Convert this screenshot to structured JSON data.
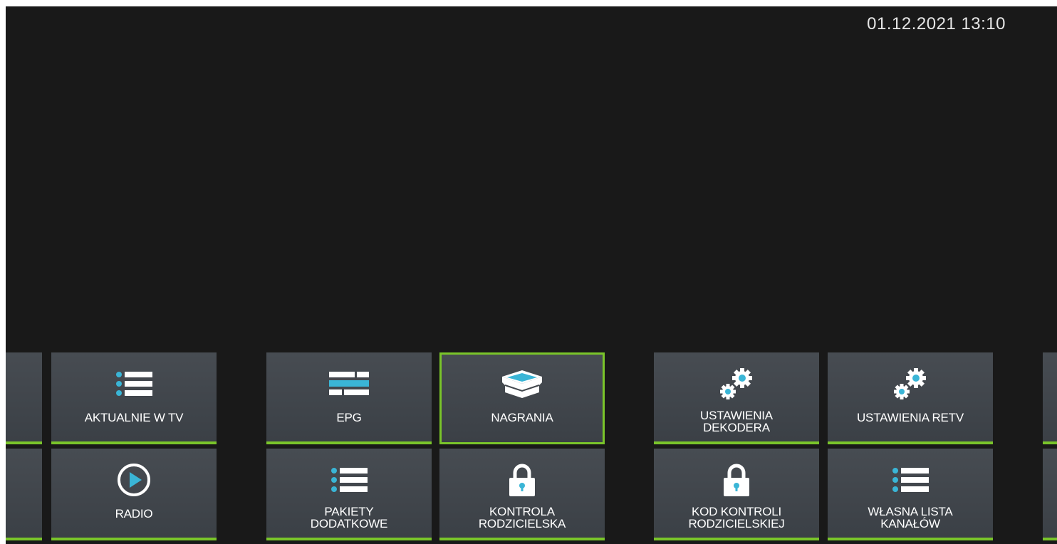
{
  "header": {
    "datetime": "01.12.2021 13:10"
  },
  "menu": {
    "row1": [
      {
        "label_lines": [
          "AKTUALNIE W TV"
        ],
        "icon": "list-icon"
      },
      {
        "label_lines": [
          "EPG"
        ],
        "icon": "epg-grid-icon"
      },
      {
        "label_lines": [
          "NAGRANIA"
        ],
        "icon": "open-box-icon",
        "focused": true
      },
      {
        "label_lines": [
          "USTAWIENIA",
          "DEKODERA"
        ],
        "icon": "gears-icon"
      },
      {
        "label_lines": [
          "USTAWIENIA RETV"
        ],
        "icon": "gears-icon"
      }
    ],
    "row2": [
      {
        "label_lines": [
          "RADIO"
        ],
        "icon": "play-circle-icon"
      },
      {
        "label_lines": [
          "PAKIETY",
          "DODATKOWE"
        ],
        "icon": "list-icon"
      },
      {
        "label_lines": [
          "KONTROLA",
          "RODZICIELSKA"
        ],
        "icon": "padlock-icon"
      },
      {
        "label_lines": [
          "KOD KONTROLI",
          "RODZICIELSKIEJ"
        ],
        "icon": "padlock-icon"
      },
      {
        "label_lines": [
          "WŁASNA LISTA",
          "KANAŁÓW"
        ],
        "icon": "list-icon"
      }
    ]
  },
  "colors": {
    "background": "#191919",
    "tile": "#43484e",
    "accent_green": "#7ac52a",
    "icon_blue": "#3ab5d6",
    "text": "#ffffff"
  }
}
